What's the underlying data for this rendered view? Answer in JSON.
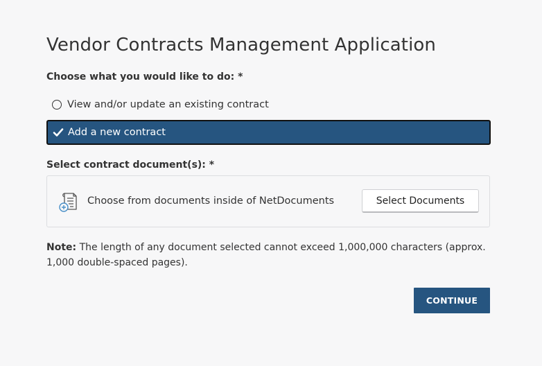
{
  "page": {
    "title": "Vendor Contracts Management Application"
  },
  "action_question": {
    "label": "Choose what you would like to do: *",
    "options": [
      {
        "label": "View and/or update an existing contract",
        "selected": false
      },
      {
        "label": "Add a new contract",
        "selected": true
      }
    ]
  },
  "document_section": {
    "label": "Select contract document(s): *",
    "source_text": "Choose from documents inside of NetDocuments",
    "select_button_label": "Select Documents",
    "icon": "document-add-icon"
  },
  "note": {
    "label": "Note:",
    "text": " The length of any document selected cannot exceed 1,000,000 characters (approx. 1,000 double-spaced pages)."
  },
  "actions": {
    "continue_label": "CONTINUE"
  },
  "colors": {
    "primary": "#265580",
    "background": "#f7f7f8",
    "text": "#333333",
    "icon_accent": "#4a90c8"
  }
}
